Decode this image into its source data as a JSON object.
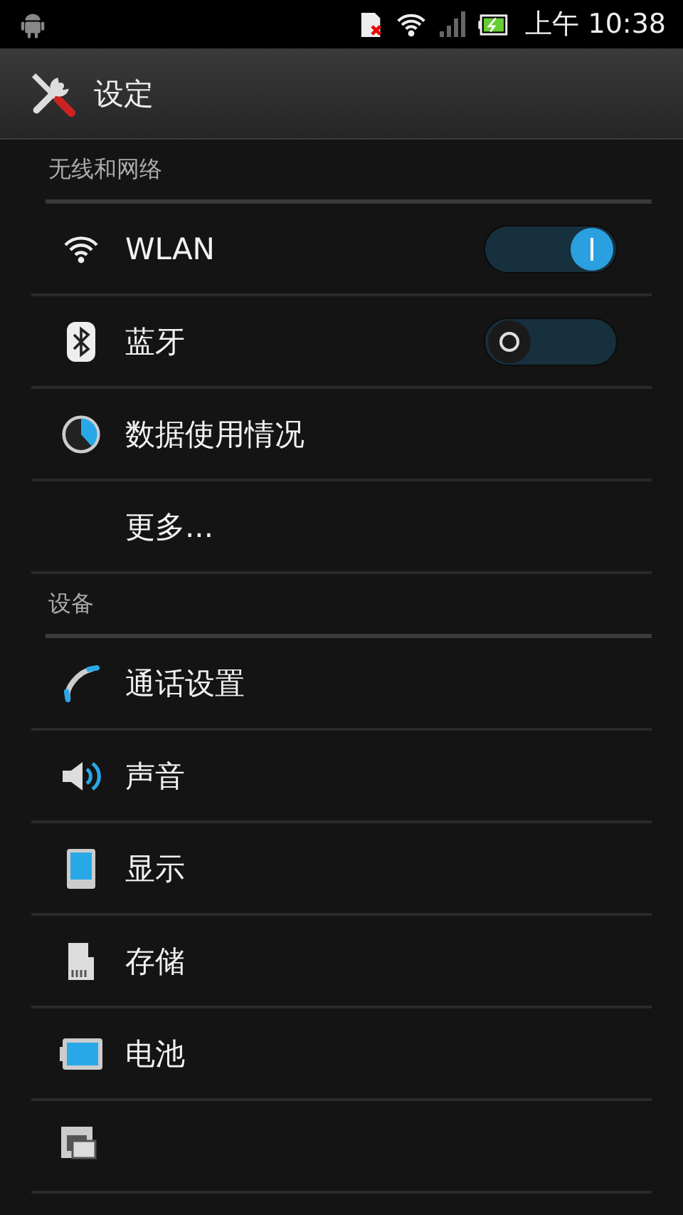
{
  "status_bar": {
    "time": "上午 10:38"
  },
  "action_bar": {
    "title": "设定"
  },
  "sections": [
    {
      "title": "无线和网络",
      "items": [
        {
          "label": "WLAN",
          "kind": "toggle",
          "on": true
        },
        {
          "label": "蓝牙",
          "kind": "toggle",
          "on": false
        },
        {
          "label": "数据使用情况",
          "kind": "plain"
        },
        {
          "label": "更多...",
          "kind": "plain"
        }
      ]
    },
    {
      "title": "设备",
      "items": [
        {
          "label": "通话设置",
          "kind": "plain"
        },
        {
          "label": "声音",
          "kind": "plain"
        },
        {
          "label": "显示",
          "kind": "plain"
        },
        {
          "label": "存储",
          "kind": "plain"
        },
        {
          "label": "电池",
          "kind": "plain"
        },
        {
          "kind": "plain"
        }
      ]
    }
  ]
}
